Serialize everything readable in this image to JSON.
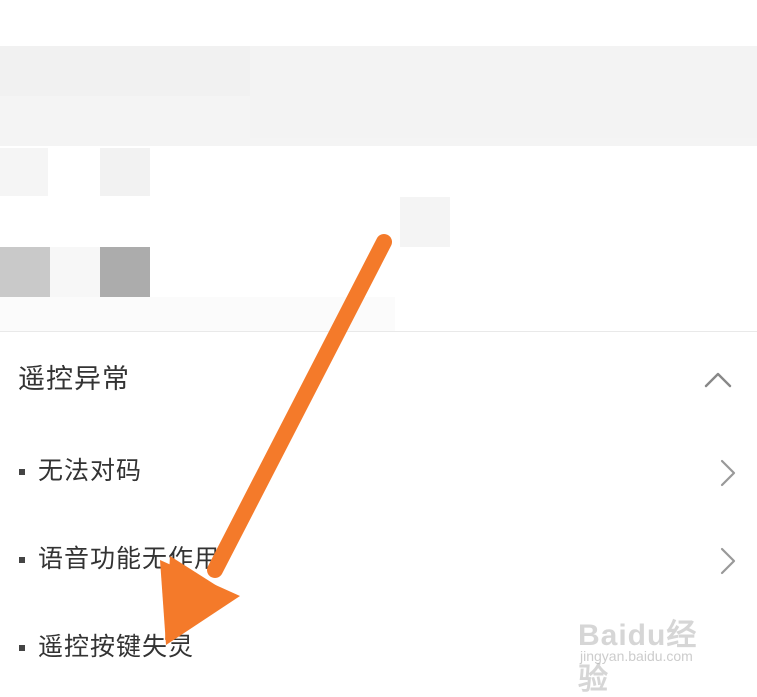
{
  "section": {
    "title": "遥控异常",
    "expanded": true
  },
  "items": [
    {
      "label": "无法对码",
      "has_chevron": true
    },
    {
      "label": "语音功能无作用",
      "has_chevron": true
    },
    {
      "label": "遥控按键失灵",
      "has_chevron": false
    }
  ],
  "watermark": {
    "logo": "Baidu经验",
    "url": "jingyan.baidu.com"
  },
  "colors": {
    "arrow": "#f47a2a",
    "text": "#333333",
    "header_band": "#f4f4f4"
  },
  "icons": {
    "collapse": "chevron-up-icon",
    "open_item": "chevron-right-icon"
  }
}
